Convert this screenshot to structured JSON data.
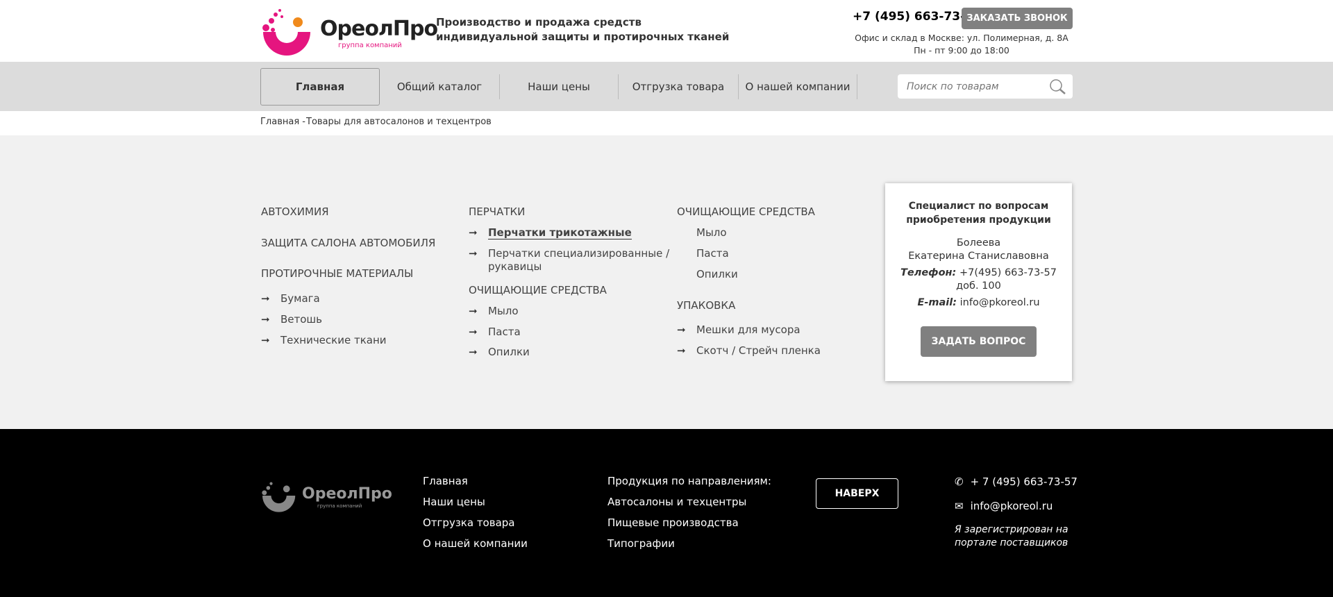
{
  "header": {
    "logo_text": "ОреолПро",
    "logo_sub": "группа компаний",
    "tagline_1": "Производство и продажа средств",
    "tagline_2": "индивидуальной защиты и протирочных тканей",
    "phone": "+7 (495) 663-73-57",
    "call_button": "ЗАКАЗАТЬ ЗВОНОК",
    "address": "Офис и склад в Москве: ул. Полимерная, д. 8А",
    "hours": "Пн - пт 9:00 до 18:00"
  },
  "nav": {
    "items": [
      {
        "label": "Главная"
      },
      {
        "label": "Общий каталог"
      },
      {
        "label": "Наши цены"
      },
      {
        "label": "Отгрузка товара"
      },
      {
        "label": "О нашей компании"
      }
    ],
    "search_placeholder": "Поиск по товарам"
  },
  "breadcrumb": {
    "home": "Главная -",
    "current": "Товары для автосалонов и техцентров"
  },
  "catalog": {
    "col1": {
      "c1": "АВТОХИМИЯ",
      "c2": "ЗАЩИТА САЛОНА АВТОМОБИЛЯ",
      "c3": "ПРОТИРОЧНЫЕ  МАТЕРИАЛЫ",
      "items": [
        "Бумага",
        "Ветошь",
        "Технические ткани"
      ]
    },
    "col2": {
      "c1": "ПЕРЧАТКИ",
      "items1": [
        "Перчатки трикотажные",
        "Перчатки специализированные /",
        "рукавицы"
      ],
      "c2": "ОЧИЩАЮЩИЕ СРЕДСТВА",
      "items2": [
        "Мыло",
        "Паста",
        "Опилки"
      ]
    },
    "col3": {
      "c1": "ОЧИЩАЮЩИЕ СРЕДСТВА",
      "items1": [
        "Мыло",
        "Паста",
        "Опилки"
      ],
      "c2": "УПАКОВКА",
      "items2": [
        "Мешки для мусора",
        "Скотч / Стрейч пленка"
      ]
    }
  },
  "specialist": {
    "title_1": "Специалист по вопросам",
    "title_2": "приобретения продукции",
    "surname": "Болеева",
    "name": "Екатерина Станиславовна",
    "phone_label": "Телефон:",
    "phone": "+7(495) 663-73-57",
    "ext": "доб. 100",
    "email_label": "E-mail:",
    "email": "info@pkoreol.ru",
    "ask_button": "ЗАДАТЬ ВОПРОС"
  },
  "footer": {
    "links1": [
      "Главная",
      "Наши цены",
      "Отгрузка товара",
      "О нашей компании"
    ],
    "links2": [
      "Продукция по направлениям:",
      "Автосалоны и техцентры",
      "Пищевые производства",
      "Типографии"
    ],
    "top_button": "НАВЕРХ",
    "phone": "+ 7 (495) 663-73-57",
    "email": "info@pkoreol.ru",
    "reg_1": "Я зарегистрирован на",
    "reg_2": "портале поставщиков"
  },
  "colors": {
    "brand_pink": "#e5157f",
    "brand_orange": "#f08a1c",
    "button_gray": "#808080"
  }
}
